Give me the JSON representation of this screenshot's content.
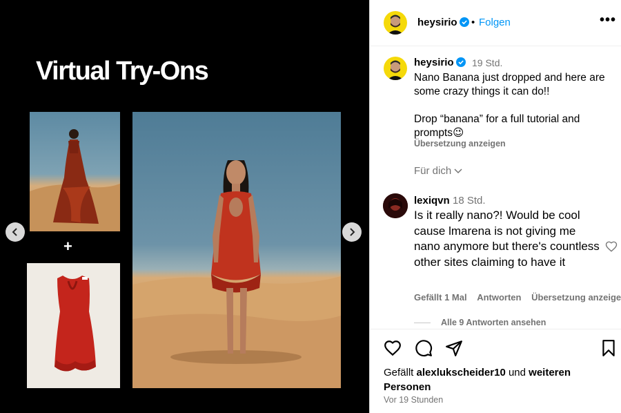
{
  "media": {
    "title": "Virtual Try-Ons",
    "plus": "+"
  },
  "header": {
    "username": "heysirio",
    "dot": "•",
    "follow_label": "Folgen",
    "more": "•••"
  },
  "caption": {
    "username": "heysirio",
    "time": "19 Std.",
    "line1": "Nano Banana just dropped and here are some crazy things it can do!!",
    "line2": "Drop “banana” for a full tutorial and prompts",
    "emoji": "😉",
    "translate": "Übersetzung anzeigen",
    "more": "Für dich"
  },
  "comment": {
    "username": "lexiqvn",
    "time": "18 Std.",
    "text": "Is it really nano?! Would be cool cause lmarena is not giving me nano anymore but there's countless other sites claiming to have it",
    "likes": "Gefällt 1 Mal",
    "reply": "Antworten",
    "translate": "Übersetzung anzeigen",
    "view_replies": "Alle 9 Antworten ansehen"
  },
  "likes": {
    "prefix": "Gefällt",
    "user": "alexlukscheider10",
    "middle": "und",
    "others": "weiteren Personen"
  },
  "post_time": "Vor 19 Stunden",
  "colors": {
    "accent": "#0095f6",
    "muted": "#737373",
    "avatar_yellow": "#f5d90a"
  }
}
